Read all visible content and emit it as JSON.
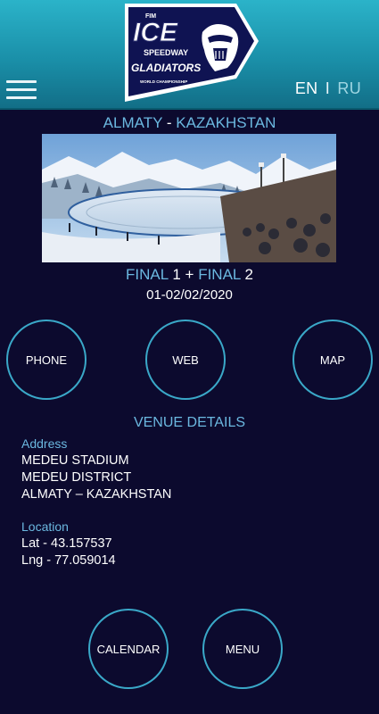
{
  "header": {
    "menu_icon": "hamburger-menu-icon",
    "logo": {
      "fim": "FIM",
      "ice": "ICE",
      "speedway": "SPEEDWAY",
      "gladiators": "GLADIATORS",
      "sub": "WORLD CHAMPIONSHIP"
    },
    "lang_en": "EN",
    "lang_sep": "I",
    "lang_ru": "RU",
    "colors": {
      "bar_top": "#2bb3c9",
      "bar_bottom": "#126d86"
    }
  },
  "event": {
    "city": "ALMATY",
    "city_sep": "-",
    "country": "KAZAKHSTAN",
    "final_a_label": "FINAL",
    "final_a_num": "1",
    "plus": "+",
    "final_b_label": "FINAL",
    "final_b_num": "2",
    "date": "01-02/02/2020"
  },
  "buttons": {
    "phone": "PHONE",
    "web": "WEB",
    "map": "MAP",
    "calendar": "CALENDAR",
    "menu": "MENU"
  },
  "venue": {
    "title": "VENUE DETAILS",
    "address_label": "Address",
    "address_line1": "MEDEU STADIUM",
    "address_line2": "MEDEU DISTRICT",
    "address_line3": "ALMATY – KAZAKHSTAN",
    "location_label": "Location",
    "lat": "Lat - 43.157537",
    "lng": "Lng - 77.059014"
  },
  "colors": {
    "background": "#0c0a2e",
    "accent_blue": "#6bb8e0",
    "button_border": "#3aa8c8"
  }
}
